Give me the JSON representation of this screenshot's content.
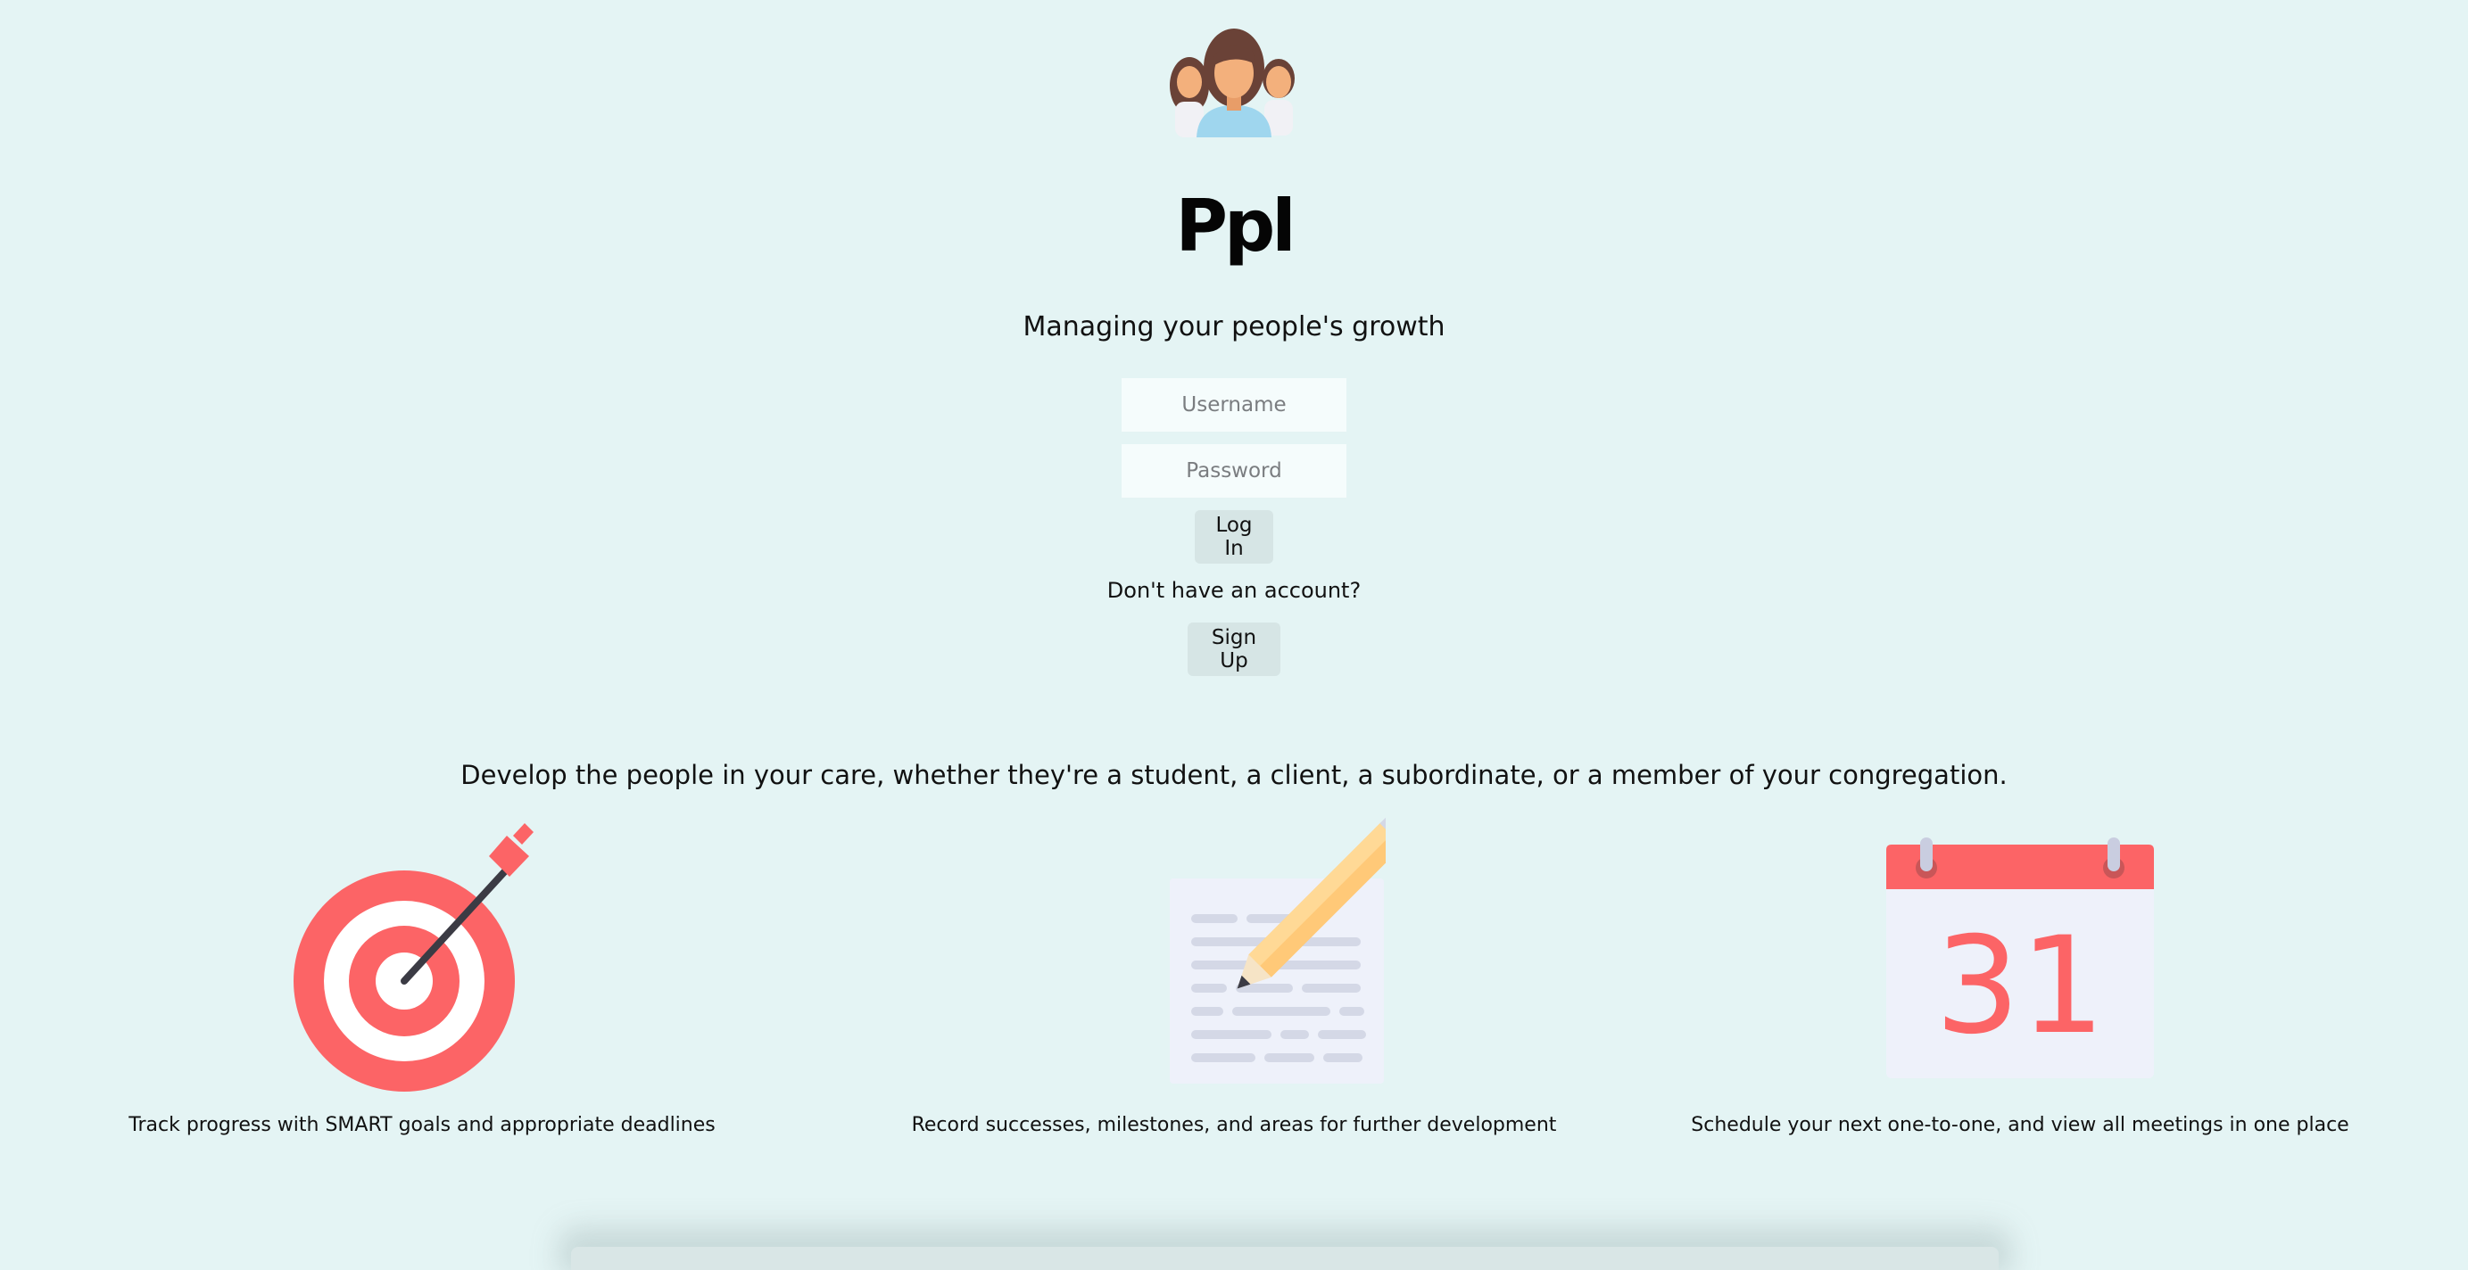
{
  "brand": {
    "app_name": "Ppl",
    "tagline": "Managing your people's growth",
    "logo_icon": "team-avatars-icon"
  },
  "login": {
    "username_placeholder": "Username",
    "password_placeholder": "Password",
    "login_label": "Log In",
    "no_account_text": "Don't have an account?",
    "signup_label": "Sign Up"
  },
  "marketing": {
    "headline": "Develop the people in your care, whether they're a student, a client, a subordinate, or a member of your congregation.",
    "features": [
      {
        "icon": "target-arrow-icon",
        "caption": "Track progress with SMART goals and appropriate deadlines"
      },
      {
        "icon": "document-pencil-icon",
        "caption": "Record successes, milestones, and areas for further development"
      },
      {
        "icon": "calendar-icon",
        "caption": "Schedule your next one-to-one, and view all meetings in one place",
        "calendar_day": "31"
      }
    ]
  },
  "colors": {
    "background": "#e4f4f4",
    "accent_red": "#fc6466",
    "input_bg": "#f5fcfc",
    "button_bg": "#d6e5e5"
  }
}
